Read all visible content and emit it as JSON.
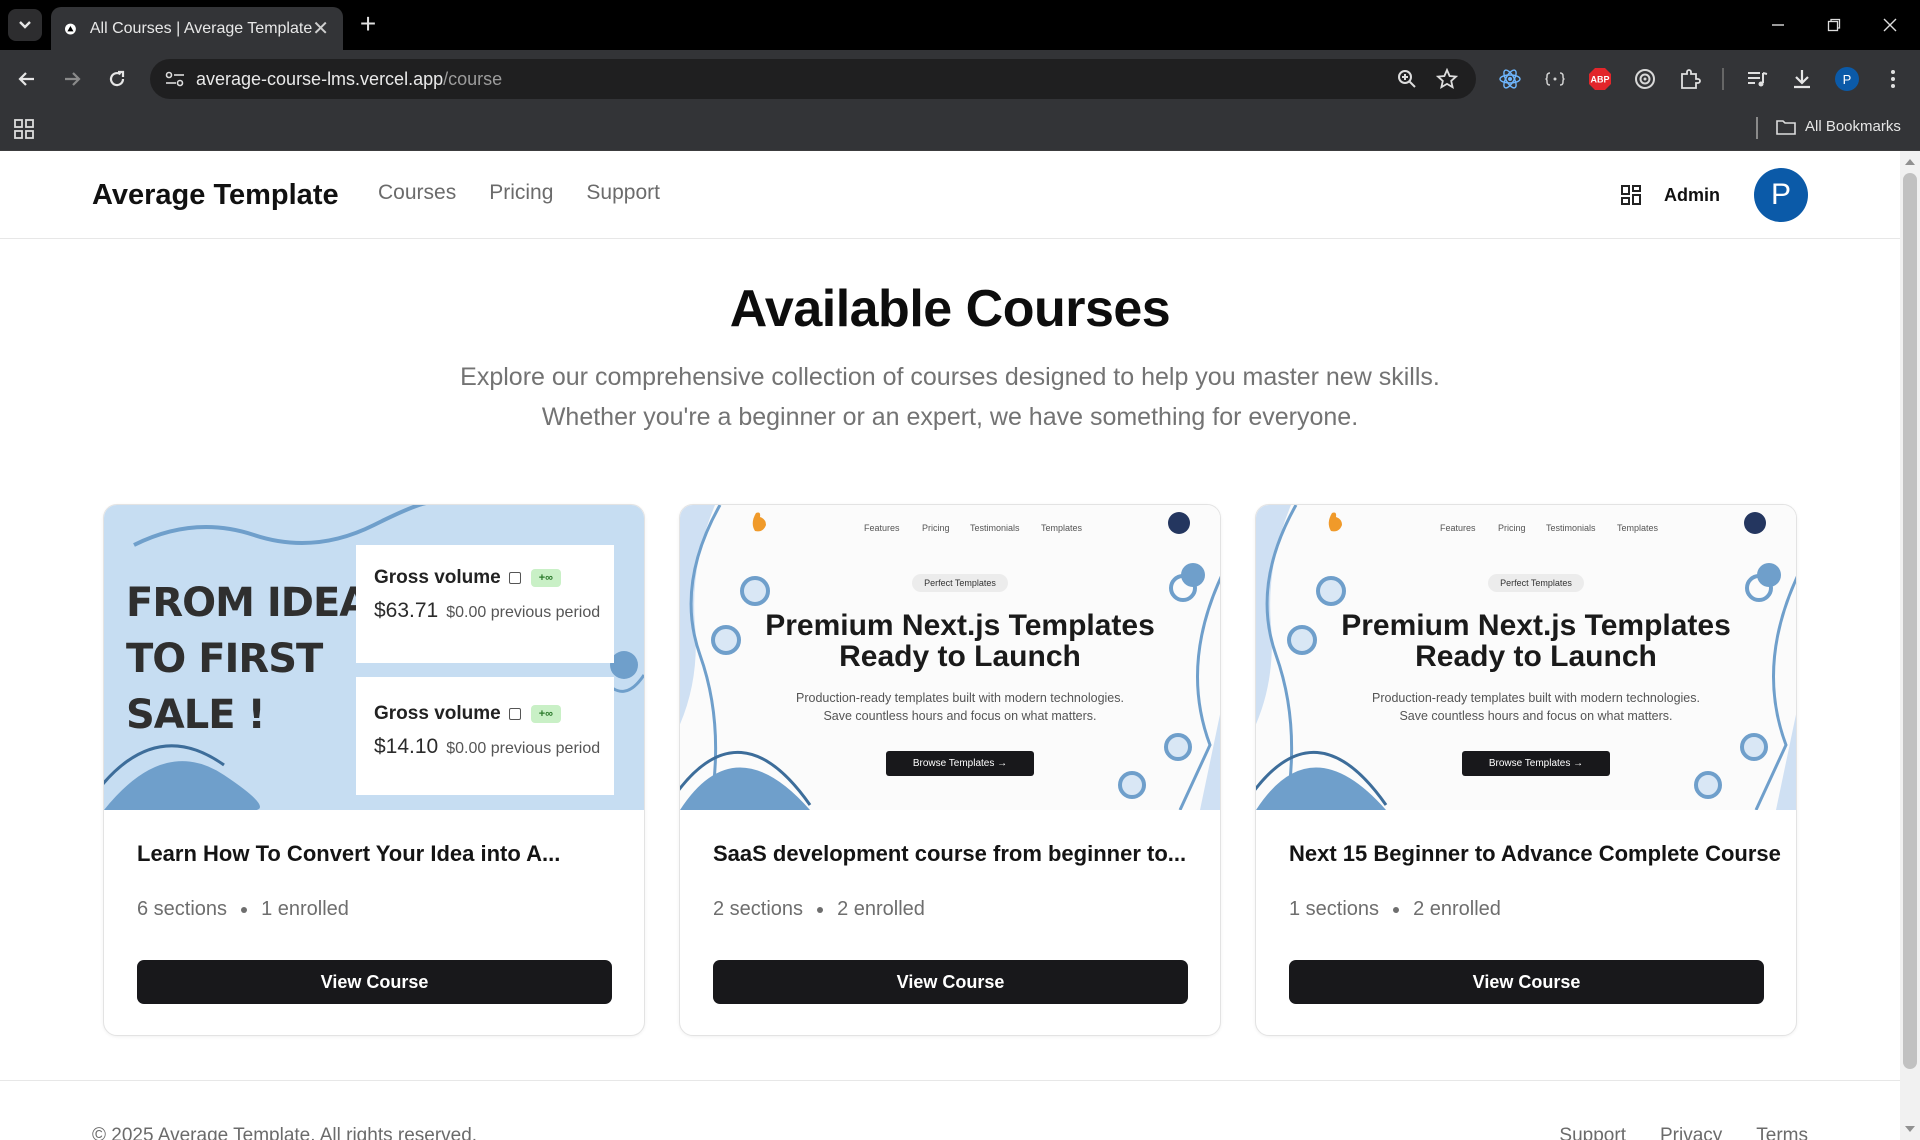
{
  "browser": {
    "tab_title": "All Courses | Average Template",
    "url_host": "average-course-lms.vercel.app",
    "url_path": "/course",
    "bookmarks_label": "All Bookmarks",
    "profile_initial": "P",
    "ext_abp": "ABP"
  },
  "header": {
    "brand": "Average Template",
    "nav": [
      "Courses",
      "Pricing",
      "Support"
    ],
    "admin_label": "Admin",
    "avatar_initial": "P"
  },
  "hero": {
    "title": "Available Courses",
    "subtitle_line1": "Explore our comprehensive collection of courses designed to help you master new skills.",
    "subtitle_line2": "Whether you're a beginner or an expert, we have something for everyone."
  },
  "courses": [
    {
      "title": "Learn How To Convert Your Idea into A...",
      "sections": "6 sections",
      "enrolled": "1 enrolled",
      "button": "View Course",
      "thumb": {
        "headline": [
          "FROM IDEA",
          "TO FIRST",
          "SALE !"
        ],
        "panels": [
          {
            "label": "Gross volume",
            "badge": "+∞",
            "value": "$63.71",
            "previous": "$0.00 previous period"
          },
          {
            "label": "Gross volume",
            "badge": "+∞",
            "value": "$14.10",
            "previous": "$0.00 previous period"
          }
        ]
      }
    },
    {
      "title": "SaaS development course from beginner to...",
      "sections": "2 sections",
      "enrolled": "2 enrolled",
      "button": "View Course",
      "thumb": {
        "nav": [
          "Features",
          "Pricing",
          "Testimonials",
          "Templates"
        ],
        "pill": "Perfect Templates",
        "title_line1": "Premium Next.js Templates",
        "title_line2": "Ready to Launch",
        "desc_line1": "Production-ready templates built with modern technologies.",
        "desc_line2": "Save countless hours and focus on what matters.",
        "cta": "Browse Templates →"
      }
    },
    {
      "title": "Next 15 Beginner to Advance Complete Course",
      "sections": "1 sections",
      "enrolled": "2 enrolled",
      "button": "View Course",
      "thumb": {
        "nav": [
          "Features",
          "Pricing",
          "Testimonials",
          "Templates"
        ],
        "pill": "Perfect Templates",
        "title_line1": "Premium Next.js Templates",
        "title_line2": "Ready to Launch",
        "desc_line1": "Production-ready templates built with modern technologies.",
        "desc_line2": "Save countless hours and focus on what matters.",
        "cta": "Browse Templates →"
      }
    }
  ],
  "footer": {
    "copyright": "© 2025 Average Template. All rights reserved.",
    "links": [
      "Support",
      "Privacy",
      "Terms"
    ]
  },
  "colors": {
    "accent": "#0b5aa8",
    "button_bg": "#18181b",
    "thumb_blue": "#c6ddf2",
    "deco_blue": "#6f9fcb"
  }
}
